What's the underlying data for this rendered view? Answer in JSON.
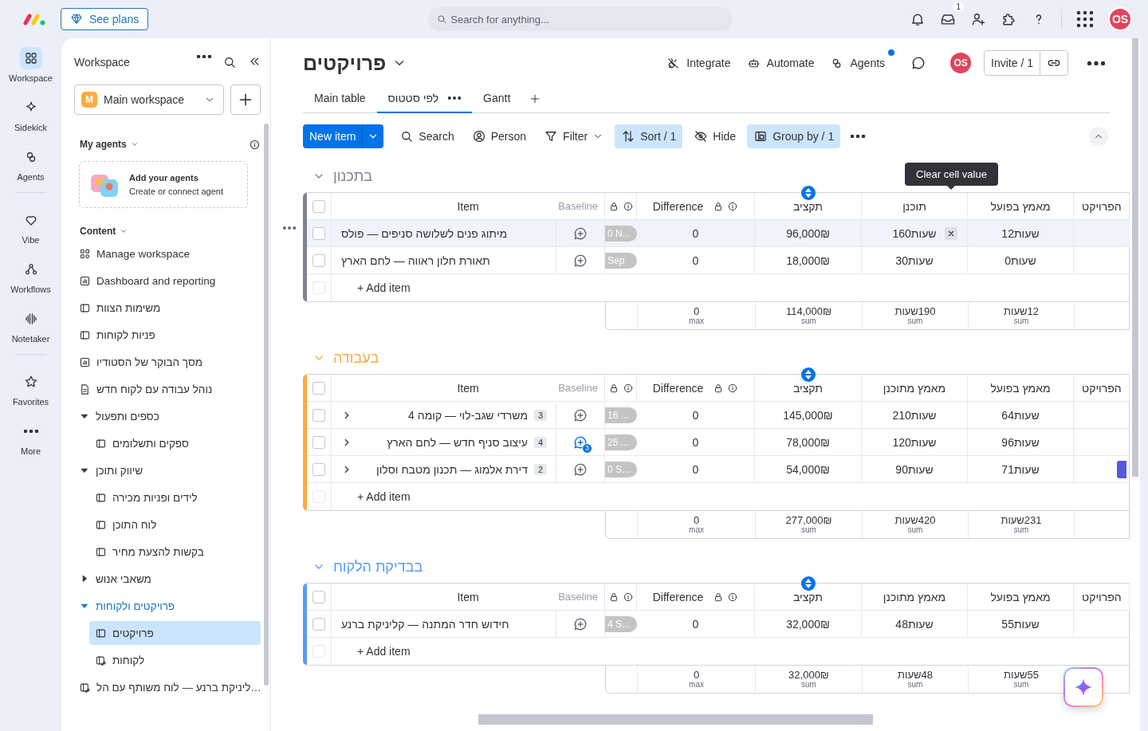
{
  "topbar": {
    "see_plans": "See plans",
    "search_placeholder": "Search for anything...",
    "inbox_badge": "1",
    "avatar": "OS"
  },
  "rail": [
    {
      "label": "Workspace",
      "selected": true
    },
    {
      "label": "Sidekick",
      "selected": false
    },
    {
      "label": "Agents",
      "selected": false
    },
    {
      "label": "Vibe",
      "selected": false
    },
    {
      "label": "Workflows",
      "selected": false
    },
    {
      "label": "Notetaker",
      "selected": false
    },
    {
      "label": "Favorites",
      "selected": false
    },
    {
      "label": "More",
      "selected": false
    }
  ],
  "sidebar": {
    "title": "Workspace",
    "workspace": "Main workspace",
    "workspace_initial": "M",
    "agents_heading": "My agents",
    "agents_card": {
      "title": "Add your agents",
      "subtitle": "Create or connect agent"
    },
    "content_heading": "Content",
    "items": [
      {
        "label": "Manage workspace",
        "kind": "manage",
        "selected": false
      },
      {
        "label": "Dashboard and reporting",
        "kind": "dashboard",
        "selected": false
      },
      {
        "label": "משימות הצוות",
        "kind": "board",
        "selected": false
      },
      {
        "label": "פניות לקוחות",
        "kind": "board",
        "selected": false
      },
      {
        "label": "מסך הבוקר של הסטודיו",
        "kind": "dashboard",
        "selected": false
      },
      {
        "label": "נוהל עבודה עם לקוח חדש",
        "kind": "doc",
        "selected": false
      },
      {
        "label": "כספים ותפעול",
        "kind": "folder",
        "expanded": true,
        "selected": false,
        "children": [
          {
            "label": "ספקים ותשלומים",
            "kind": "board",
            "selected": false
          }
        ]
      },
      {
        "label": "שיווק ותוכן",
        "kind": "folder",
        "expanded": true,
        "selected": false,
        "children": [
          {
            "label": "לידים ופניות מכירה",
            "kind": "board",
            "selected": false
          },
          {
            "label": "לוח התוכן",
            "kind": "board",
            "selected": false
          },
          {
            "label": "בקשות להצעת מחיר",
            "kind": "board",
            "selected": false
          }
        ]
      },
      {
        "label": "משאבי אנוש",
        "kind": "folder",
        "expanded": false,
        "selected": false
      },
      {
        "label": "פרויקטים ולקוחות",
        "kind": "folder",
        "expanded": true,
        "selected": false,
        "children": [
          {
            "label": "פרויקטים",
            "kind": "board",
            "selected": true
          },
          {
            "label": "לקוחות",
            "kind": "shared",
            "selected": false
          }
        ]
      },
      {
        "label": "…ליניקת ברנע — לוח משותף עם הל",
        "kind": "shared",
        "selected": false
      }
    ]
  },
  "board": {
    "title": "פרויקטים",
    "views": [
      {
        "label": "Gantt",
        "selected": false
      },
      {
        "label": "לפי סטטוס",
        "selected": true
      },
      {
        "label": "Main table",
        "selected": false
      }
    ],
    "actions": [
      {
        "label": "Agents",
        "notification": true
      },
      {
        "label": "Automate",
        "notification": false
      },
      {
        "label": "Integrate",
        "notification": false
      }
    ],
    "avatar": "OS",
    "invite": "Invite / 1",
    "toolbar": {
      "new_item": "New item",
      "items": [
        {
          "label": "Group by / 1",
          "active": true
        },
        {
          "label": "Hide",
          "active": false
        },
        {
          "label": "Sort / 1",
          "active": true
        },
        {
          "label": "Filter",
          "active": false
        },
        {
          "label": "Person",
          "active": false
        },
        {
          "label": "Search",
          "active": false
        }
      ]
    }
  },
  "groups": [
    {
      "title": "בתכנון",
      "color": "#808392",
      "all_checked": false,
      "add_row_checkbox_disabled": true,
      "columns": [
        "הפרויקט",
        "מאמץ בפועל",
        "תוכנן",
        "תקציב",
        "Difference",
        "Baseline",
        "Item"
      ],
      "tooltip": "Clear cell value",
      "rows": [
        {
          "item": "מיתוג פנים לשלושה סניפים — פולס",
          "checked": false,
          "highlighted": true,
          "baseline": "0 N...",
          "difference": "0",
          "budget": "96,000₪",
          "planned": "שעות160",
          "actual": "12שעות",
          "clear_button": true,
          "project_chip": false
        },
        {
          "item": "תאורת חלון ראווה — לחם הארץ",
          "checked": false,
          "highlighted": false,
          "baseline": "Sep",
          "difference": "0",
          "budget": "18,000₪",
          "planned": "30שעות",
          "actual": "0שעות",
          "clear_button": false,
          "project_chip": false
        }
      ],
      "add_item": "+ Add item",
      "summary": [
        {
          "value": "12שעות",
          "label": "sum"
        },
        {
          "value": "190שעות",
          "label": "sum"
        },
        {
          "value": "114,000₪",
          "label": "sum"
        },
        {
          "value": "0",
          "label": "max"
        }
      ]
    },
    {
      "title": "בעבודה",
      "color": "#fdab3d",
      "all_checked": false,
      "add_row_checkbox_disabled": true,
      "columns": [
        "הפרויקט",
        "מאמץ בפועל",
        "מאמץ מתוכנן",
        "תקציב",
        "Difference",
        "Baseline",
        "Item"
      ],
      "rows": [
        {
          "item": "משרדי שגב-לוי — קומה 4",
          "subitems": "3",
          "checked": false,
          "highlighted": false,
          "baseline": "16 ...",
          "difference": "0",
          "budget": "145,000₪",
          "planned": "210שעות",
          "actual": "64שעות",
          "clear_button": false,
          "project_chip": false
        },
        {
          "item": "עיצוב סניף חדש — לחם הארץ",
          "subitems": "4",
          "updates": "3",
          "checked": false,
          "highlighted": false,
          "baseline": "25 ...",
          "difference": "0",
          "budget": "78,000₪",
          "planned": "120שעות",
          "actual": "96שעות",
          "clear_button": false,
          "project_chip": false
        },
        {
          "item": "דירת אלמוג — תכנון מטבח וסלון",
          "subitems": "2",
          "checked": false,
          "highlighted": false,
          "baseline": "0 S...",
          "difference": "0",
          "budget": "54,000₪",
          "planned": "90שעות",
          "actual": "71שעות",
          "clear_button": false,
          "project_chip": true
        }
      ],
      "add_item": "+ Add item",
      "summary": [
        {
          "value": "231שעות",
          "label": "sum"
        },
        {
          "value": "420שעות",
          "label": "sum"
        },
        {
          "value": "277,000₪",
          "label": "sum"
        },
        {
          "value": "0",
          "label": "max"
        }
      ]
    },
    {
      "title": "בבדיקת הלקוח",
      "color": "#579bfc",
      "all_checked": false,
      "add_row_checkbox_disabled": true,
      "columns": [
        "הפרויקט",
        "מאמץ בפועל",
        "מאמץ מתוכנן",
        "תקציב",
        "Difference",
        "Baseline",
        "Item"
      ],
      "rows": [
        {
          "item": "חידוש חדר המתנה — קליניקת ברנע",
          "checked": false,
          "highlighted": false,
          "baseline": "4 S...",
          "difference": "0",
          "budget": "32,000₪",
          "planned": "48שעות",
          "actual": "55שעות",
          "clear_button": false,
          "project_chip": false
        }
      ],
      "add_item": "+ Add item",
      "summary": [
        {
          "value": "55שעות",
          "label": "sum"
        },
        {
          "value": "48שעות",
          "label": "sum"
        },
        {
          "value": "32,000₪",
          "label": "sum"
        },
        {
          "value": "0",
          "label": "max"
        }
      ]
    }
  ]
}
